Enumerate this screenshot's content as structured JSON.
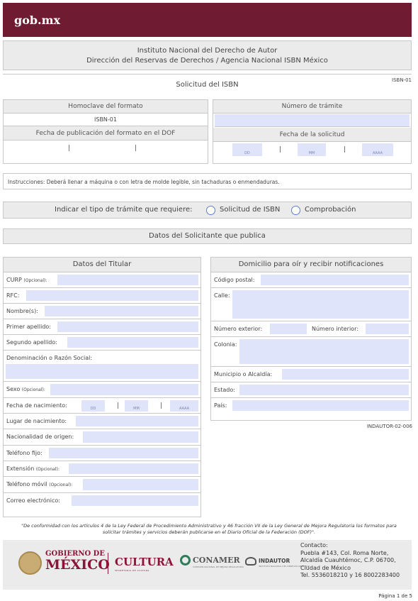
{
  "header": {
    "logo": "gob.mx"
  },
  "institute": {
    "line1": "Instituto Nacional del Derecho de Autor",
    "line2": "Dirección del Reservas de Derechos / Agencia Nacional ISBN México"
  },
  "form_code": "ISBN-01",
  "request_title": "Solicitud del ISBN",
  "format_block": {
    "homoclave_label": "Homoclave del formato",
    "homoclave_value": "ISBN-01",
    "pub_date_label": "Fecha de publicación del formato en el DOF"
  },
  "tramite_block": {
    "number_label": "Número de trámite",
    "date_label": "Fecha de la solicitud",
    "dd": "DD",
    "mm": "MM",
    "aaaa": "AAAA"
  },
  "instructions": "Instrucciones: Deberá llenar a máquina o con letra de molde legible, sin tachaduras o enmendaduras.",
  "tramite_type": {
    "label": "Indicar el tipo de trámite que requiere:",
    "options": [
      "Solicitud de ISBN",
      "Comprobación"
    ]
  },
  "applicant_section": "Datos del Solicitante que publica",
  "titular": {
    "title": "Datos del Titular",
    "curp": "CURP",
    "optional": "(Opcional):",
    "rfc": "RFC:",
    "nombre": "Nombre(s):",
    "primer_apellido": "Primer apellido:",
    "segundo_apellido": "Segundo apellido:",
    "denominacion": "Denominación o Razón Social:",
    "sexo": "Sexo",
    "fecha_nac": "Fecha de nacimiento:",
    "lugar_nac": "Lugar de nacimiento:",
    "nacionalidad": "Nacionalidad de origen:",
    "telefono_fijo": "Teléfono fijo:",
    "extension": "Extensión",
    "telefono_movil": "Teléfono móvil",
    "correo": "Correo electrónico:"
  },
  "domicilio": {
    "title": "Domicilio para oír y recibir notificaciones",
    "codigo_postal": "Código postal:",
    "calle": "Calle:",
    "numero_exterior": "Número exterior:",
    "numero_interior": "Número interior:",
    "colonia": "Colonia:",
    "municipio": "Municipio o Alcaldía:",
    "estado": "Estado:",
    "pais": "País:"
  },
  "indautor_code": "INDAUTOR-02-006",
  "legal_note": "\"De conformidad con los artículos 4 de la Ley Federal de Procedimiento Administrativo y 46 fracción VII de la Ley General de Mejora Regulatoria los formatos para solicitar trámites y servicios deberán publicarse en el Diario Oficial de la Federación (DOF)\".",
  "footer": {
    "gobierno_de": "GOBIERNO DE",
    "mexico": "MÉXICO",
    "cultura": "CULTURA",
    "secretaria": "SECRETARÍA DE CULTURA",
    "conamer": "CONAMER",
    "conamer_sub": "COMISIÓN NACIONAL DE MEJORA REGULATORIA",
    "indautor": "INDAUTOR",
    "indautor_sub": "INSTITUTO NACIONAL DEL DERECHO DE AUTOR",
    "contact": [
      "Contacto:",
      "Puebla #143, Col. Roma Norte,",
      "Alcaldía Cuauhtémoc, C.P. 06700,",
      "Ciudad de México",
      "Tel. 5536018210 y 16  8002283400"
    ]
  },
  "page": "Página 1 de 5",
  "colors": {
    "brand": "#6f1c32",
    "field": "#dfe4fb",
    "panel": "#ebebeb",
    "radio": "#5b7fc7"
  }
}
